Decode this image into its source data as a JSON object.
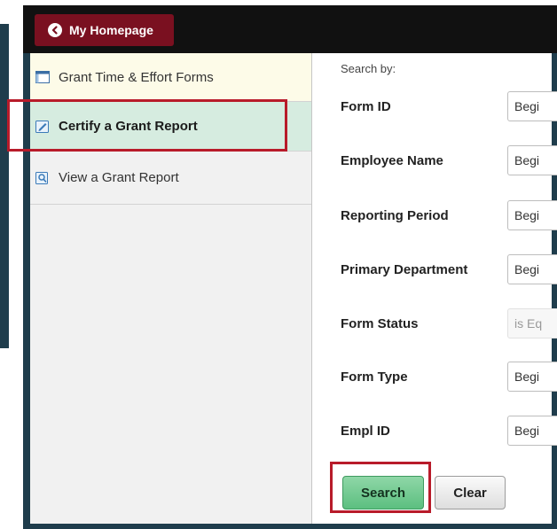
{
  "header": {
    "home_label": "My Homepage",
    "home_icon": "chevron-left-icon"
  },
  "sidebar": {
    "items": [
      {
        "label": "Grant Time & Effort Forms",
        "icon": "table-icon",
        "selected": false
      },
      {
        "label": "Certify a Grant Report",
        "icon": "edit-icon",
        "selected": true
      },
      {
        "label": "View a Grant Report",
        "icon": "search-doc-icon",
        "selected": false
      }
    ]
  },
  "search": {
    "heading": "Search by:",
    "fields": [
      {
        "label": "Form ID",
        "operator": "Begi",
        "disabled": false
      },
      {
        "label": "Employee Name",
        "operator": "Begi",
        "disabled": false
      },
      {
        "label": "Reporting Period",
        "operator": "Begi",
        "disabled": false
      },
      {
        "label": "Primary Department",
        "operator": "Begi",
        "disabled": false
      },
      {
        "label": "Form Status",
        "operator": "is Eq",
        "disabled": true
      },
      {
        "label": "Form Type",
        "operator": "Begi",
        "disabled": false
      },
      {
        "label": "Empl ID",
        "operator": "Begi",
        "disabled": false
      }
    ],
    "search_button": "Search",
    "clear_button": "Clear"
  },
  "colors": {
    "frame": "#1f3d4c",
    "home_button": "#7a1020",
    "highlight_border": "#b81b2a",
    "selected_item": "#d6ece0",
    "search_button": "#5cbf80"
  }
}
